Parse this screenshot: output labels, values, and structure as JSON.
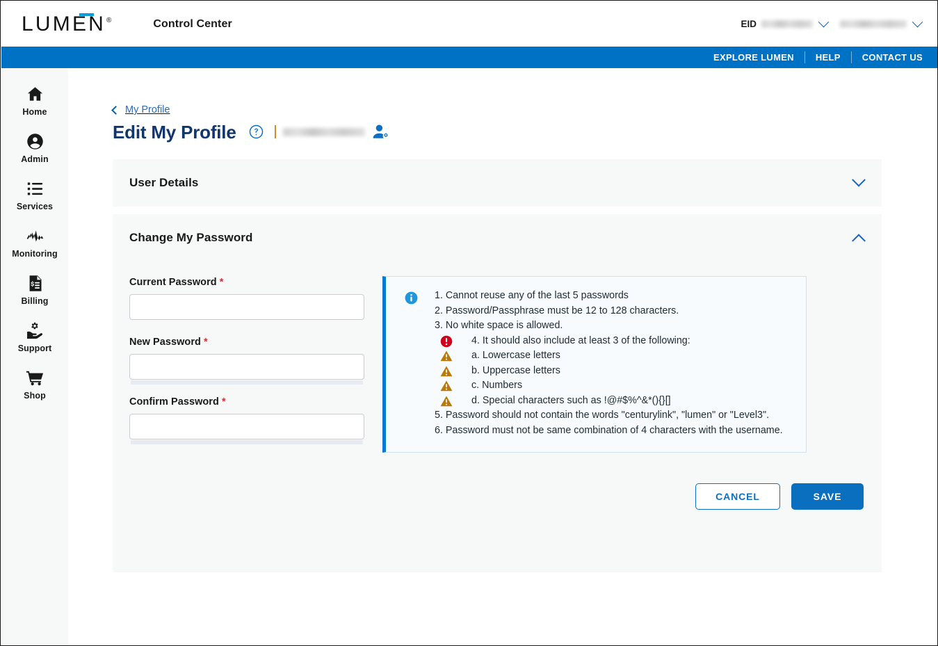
{
  "brand": {
    "logo_text": "LUMEN",
    "logo_registered": "®",
    "app_title": "Control Center",
    "accent_blue": "#0d9ddb",
    "nav_blue": "#0072c6",
    "title_navy": "#11366b"
  },
  "topbar": {
    "eid_label": "EID",
    "eid_value": "",
    "user_name": "",
    "eid_caret": "chevron-down-icon",
    "user_caret": "chevron-down-icon"
  },
  "navbar": {
    "links": [
      {
        "label": "EXPLORE LUMEN"
      },
      {
        "label": "HELP"
      },
      {
        "label": "CONTACT US"
      }
    ]
  },
  "sidebar": {
    "items": [
      {
        "label": "Home",
        "icon": "home-icon"
      },
      {
        "label": "Admin",
        "icon": "user-circle-icon"
      },
      {
        "label": "Services",
        "icon": "list-icon"
      },
      {
        "label": "Monitoring",
        "icon": "pulse-icon"
      },
      {
        "label": "Billing",
        "icon": "invoice-icon"
      },
      {
        "label": "Support",
        "icon": "gear-hand-icon"
      },
      {
        "label": "Shop",
        "icon": "cart-icon"
      }
    ]
  },
  "page": {
    "breadcrumb": "My Profile",
    "title": "Edit My Profile",
    "help_icon": "question-circle-icon",
    "profile_name": "",
    "person_gear_icon": "user-settings-icon"
  },
  "sections": {
    "user_details": {
      "title": "User Details",
      "expanded": false,
      "caret": "chevron-down-icon"
    },
    "change_password": {
      "title": "Change My Password",
      "expanded": true,
      "caret": "chevron-up-icon"
    }
  },
  "form": {
    "required_marker": "*",
    "fields": [
      {
        "label": "Current Password",
        "value": "",
        "placeholder": "",
        "required": true,
        "meter": false
      },
      {
        "label": "New Password",
        "value": "",
        "placeholder": "",
        "required": true,
        "meter": true
      },
      {
        "label": "Confirm Password",
        "value": "",
        "placeholder": "",
        "required": true,
        "meter": true
      }
    ]
  },
  "info_panel": {
    "icon": "info-circle-icon",
    "accent_color": "#0a7ad1",
    "background": "#f7fbfe",
    "rules": [
      {
        "text": "1. Cannot reuse any of the last 5 passwords",
        "badge": null
      },
      {
        "text": "2. Password/Passphrase must be 12 to 128 characters.",
        "badge": null
      },
      {
        "text": "3. No white space is allowed.",
        "badge": null
      },
      {
        "text": "4. It should also include at least 3 of the following:",
        "badge": "error-icon"
      },
      {
        "text": "a. Lowercase letters",
        "badge": "warning-icon"
      },
      {
        "text": "b. Uppercase letters",
        "badge": "warning-icon"
      },
      {
        "text": "c. Numbers",
        "badge": "warning-icon"
      },
      {
        "text": "d. Special characters such as !@#$%^&*(){}[]",
        "badge": "warning-icon"
      },
      {
        "text": "5. Password should not contain the words \"centurylink\", \"lumen\" or \"Level3\".",
        "badge": null
      },
      {
        "text": "6. Password must not be same combination of 4 characters with the username.",
        "badge": null,
        "wrap": true
      }
    ]
  },
  "actions": {
    "cancel_label": "CANCEL",
    "save_label": "SAVE"
  }
}
